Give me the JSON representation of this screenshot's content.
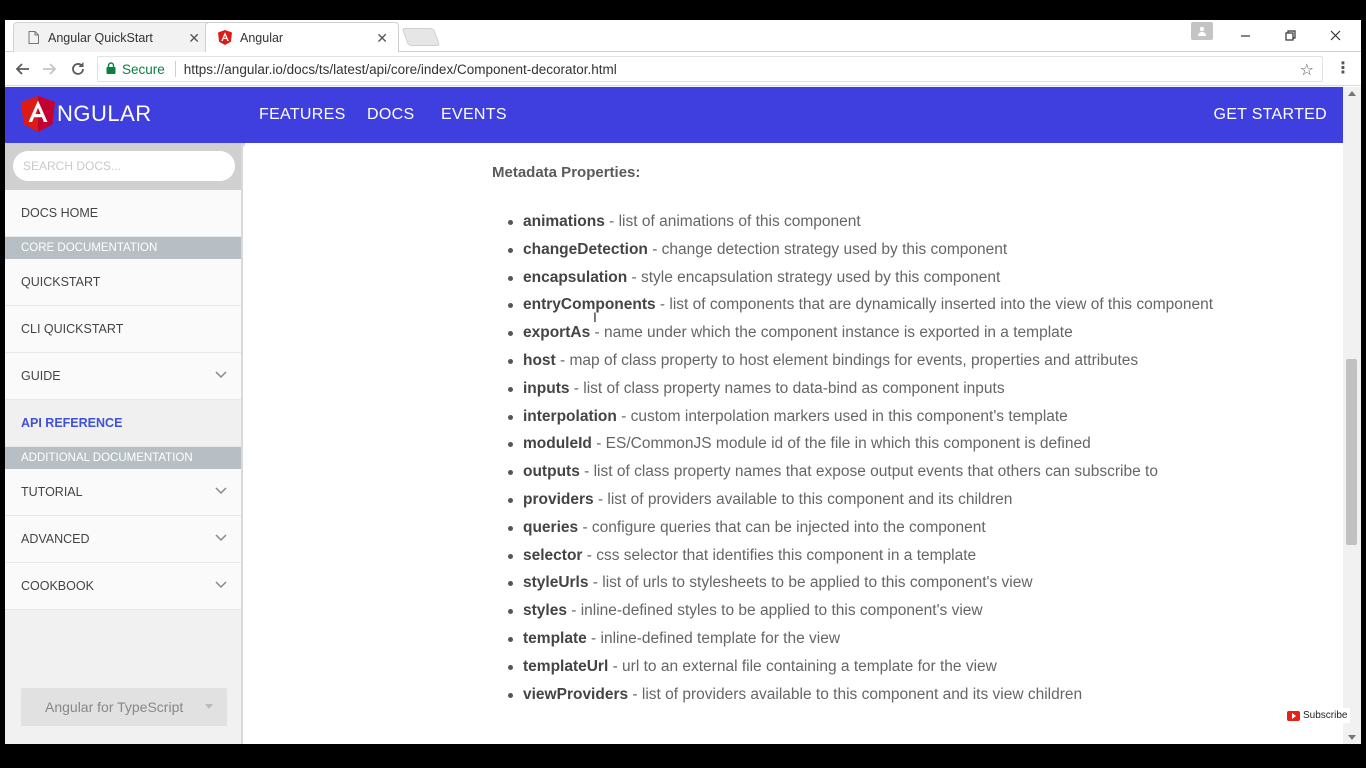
{
  "browser": {
    "tabs": [
      {
        "title": "Angular QuickStart",
        "icon": "document-icon"
      },
      {
        "title": "Angular",
        "icon": "angular-icon"
      }
    ],
    "secure_label": "Secure",
    "url": "https://angular.io/docs/ts/latest/api/core/index/Component-decorator.html"
  },
  "header": {
    "logo_text": "NGULAR",
    "nav": [
      "FEATURES",
      "DOCS",
      "EVENTS"
    ],
    "get_started": "GET STARTED",
    "brand_color": "#3f3fe0"
  },
  "sidebar": {
    "search_placeholder": "SEARCH DOCS...",
    "items": [
      {
        "label": "DOCS HOME"
      },
      {
        "section": "CORE DOCUMENTATION"
      },
      {
        "label": "QUICKSTART"
      },
      {
        "label": "CLI QUICKSTART"
      },
      {
        "label": "GUIDE",
        "expandable": true
      },
      {
        "label": "API REFERENCE",
        "active": true
      },
      {
        "section": "ADDITIONAL DOCUMENTATION"
      },
      {
        "label": "TUTORIAL",
        "expandable": true
      },
      {
        "label": "ADVANCED",
        "expandable": true
      },
      {
        "label": "COOKBOOK",
        "expandable": true
      }
    ],
    "language_select": "Angular for TypeScript"
  },
  "main": {
    "title": "Metadata Properties:",
    "properties": [
      {
        "name": "animations",
        "desc": " - list of animations of this component"
      },
      {
        "name": "changeDetection",
        "desc": " - change detection strategy used by this component"
      },
      {
        "name": "encapsulation",
        "desc": " - style encapsulation strategy used by this component"
      },
      {
        "name": "entryComponents",
        "desc": " - list of components that are dynamically inserted into the view of this component"
      },
      {
        "name": "exportAs",
        "desc": " - name under which the component instance is exported in a template"
      },
      {
        "name": "host",
        "desc": " - map of class property to host element bindings for events, properties and attributes"
      },
      {
        "name": "inputs",
        "desc": " - list of class property names to data-bind as component inputs"
      },
      {
        "name": "interpolation",
        "desc": " - custom interpolation markers used in this component's template"
      },
      {
        "name": "moduleId",
        "desc": " - ES/CommonJS module id of the file in which this component is defined"
      },
      {
        "name": "outputs",
        "desc": " - list of class property names that expose output events that others can subscribe to"
      },
      {
        "name": "providers",
        "desc": " - list of providers available to this component and its children"
      },
      {
        "name": "queries",
        "desc": " - configure queries that can be injected into the component"
      },
      {
        "name": "selector",
        "desc": " - css selector that identifies this component in a template"
      },
      {
        "name": "styleUrls",
        "desc": " - list of urls to stylesheets to be applied to this component's view"
      },
      {
        "name": "styles",
        "desc": " - inline-defined styles to be applied to this component's view"
      },
      {
        "name": "template",
        "desc": " - inline-defined template for the view"
      },
      {
        "name": "templateUrl",
        "desc": " - url to an external file containing a template for the view"
      },
      {
        "name": "viewProviders",
        "desc": " - list of providers available to this component and its view children"
      }
    ]
  },
  "overlay": {
    "subscribe": "Subscribe"
  }
}
